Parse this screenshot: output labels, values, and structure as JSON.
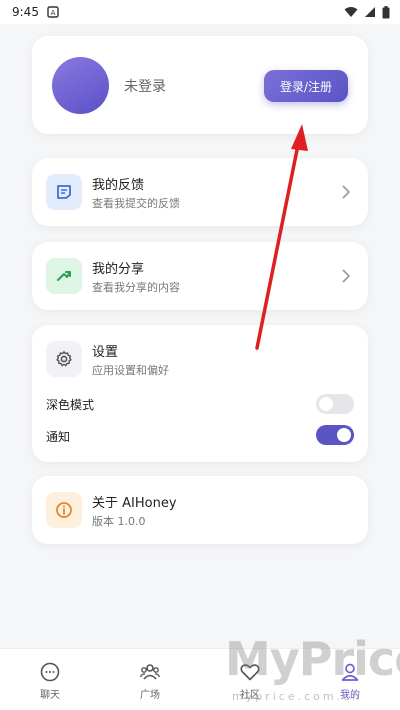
{
  "status_bar": {
    "time": "9:45"
  },
  "profile": {
    "name": "未登录",
    "login_label": "登录/注册"
  },
  "feedback": {
    "title": "我的反馈",
    "subtitle": "查看我提交的反馈"
  },
  "share": {
    "title": "我的分享",
    "subtitle": "查看我分享的内容"
  },
  "settings": {
    "title": "设置",
    "subtitle": "应用设置和偏好",
    "dark_mode_label": "深色模式",
    "dark_mode_on": false,
    "notify_label": "通知",
    "notify_on": true
  },
  "about": {
    "title": "关于 AIHoney",
    "subtitle": "版本 1.0.0"
  },
  "nav": [
    {
      "label": "聊天",
      "icon": "chat-icon"
    },
    {
      "label": "广场",
      "icon": "plaza-icon"
    },
    {
      "label": "社区",
      "icon": "heart-icon"
    },
    {
      "label": "我的",
      "icon": "user-icon",
      "active": true
    }
  ],
  "watermark": {
    "text": "MyPrice",
    "sub": "myprice.com.cn"
  },
  "colors": {
    "accent": "#5a54c4",
    "toggle_off": "#e6e6ea",
    "arrow": "#e02020"
  }
}
